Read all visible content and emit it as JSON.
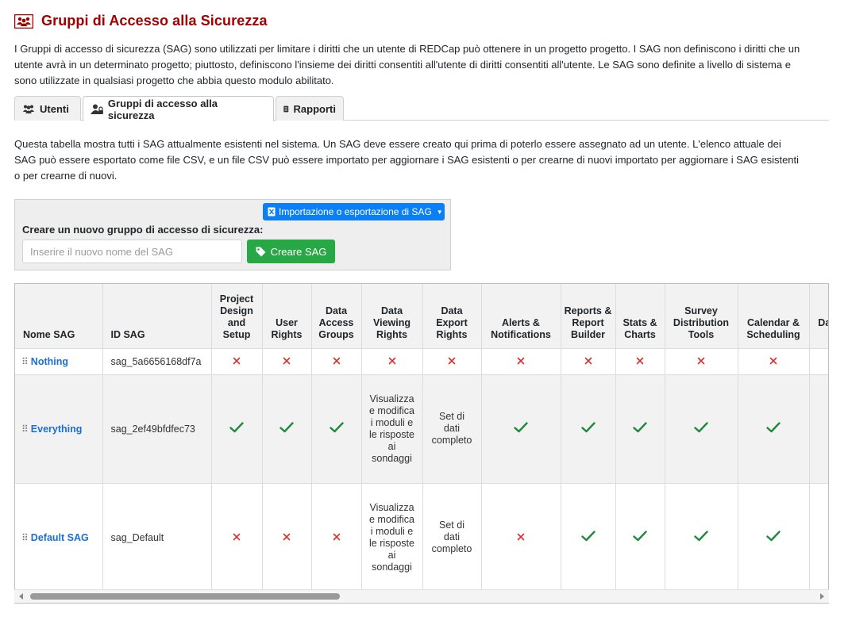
{
  "page": {
    "title": "Gruppi di Accesso alla Sicurezza",
    "intro": "I Gruppi di accesso di sicurezza (SAG) sono utilizzati per limitare i diritti che un utente di REDCap può ottenere in un progetto progetto. I SAG non definiscono i diritti che un utente avrà in un determinato progetto; piuttosto, definiscono l'insieme dei diritti consentiti all'utente di diritti consentiti all'utente. Le SAG sono definite a livello di sistema e sono utilizzate in qualsiasi progetto che abbia questo modulo abilitato."
  },
  "tabs": [
    {
      "label": "Utenti",
      "icon": "users-icon"
    },
    {
      "label": "Gruppi di accesso alla sicurezza",
      "icon": "user-lock-icon"
    },
    {
      "label": "Rapporti",
      "icon": "file-icon"
    }
  ],
  "description": "Questa tabella mostra tutti i SAG attualmente esistenti nel sistema. Un SAG deve essere creato qui prima di poterlo essere assegnato ad un utente. L'elenco attuale dei SAG può essere esportato come file CSV, e un file CSV può essere importato per aggiornare i SAG esistenti o per crearne di nuovi importato per aggiornare i SAG esistenti o per crearne di nuovi.",
  "create_panel": {
    "import_export_label": "Importazione o esportazione di SAG",
    "label": "Creare un nuovo gruppo di accesso di sicurezza:",
    "input_placeholder": "Inserire il nuovo nome del SAG",
    "input_value": "",
    "create_button": "Creare SAG"
  },
  "table": {
    "headers": {
      "name": "Nome SAG",
      "id": "ID SAG",
      "project_design": "Project Design and Setup",
      "user_rights": "User Rights",
      "data_access_groups": "Data Access Groups",
      "data_viewing": "Data Viewing Rights",
      "data_export": "Data Export Rights",
      "alerts": "Alerts & Notifications",
      "reports": "Reports & Report Builder",
      "stats": "Stats & Charts",
      "survey_distribution": "Survey Distribution Tools",
      "calendar": "Calendar & Scheduling",
      "data_import": "Data Import Tool"
    },
    "rows": [
      {
        "name": "Nothing",
        "id": "sag_5a6656168df7a",
        "project_design": "no",
        "user_rights": "no",
        "data_access_groups": "no",
        "data_viewing": "no",
        "data_export": "no",
        "alerts": "no",
        "reports": "no",
        "stats": "no",
        "survey_distribution": "no",
        "calendar": "no",
        "data_import": ""
      },
      {
        "name": "Everything",
        "id": "sag_2ef49bfdfec73",
        "project_design": "yes",
        "user_rights": "yes",
        "data_access_groups": "yes",
        "data_viewing_text": "Visualizza e modifica i moduli e le risposte ai sondaggi",
        "data_export_text": "Set di dati completo",
        "alerts": "yes",
        "reports": "yes",
        "stats": "yes",
        "survey_distribution": "yes",
        "calendar": "yes",
        "data_import": ""
      },
      {
        "name": "Default SAG",
        "id": "sag_Default",
        "project_design": "no",
        "user_rights": "no",
        "data_access_groups": "no",
        "data_viewing_text": "Visualizza e modifica i moduli e le risposte ai sondaggi",
        "data_export_text": "Set di dati completo",
        "alerts": "no",
        "reports": "yes",
        "stats": "yes",
        "survey_distribution": "yes",
        "calendar": "yes",
        "data_import": ""
      }
    ]
  },
  "colors": {
    "title": "#a00000",
    "link": "#1a6fd0",
    "check": "#1e8a3c",
    "cross": "#d9302c",
    "primary_button": "#0d7ff5",
    "success_button": "#28a745"
  }
}
